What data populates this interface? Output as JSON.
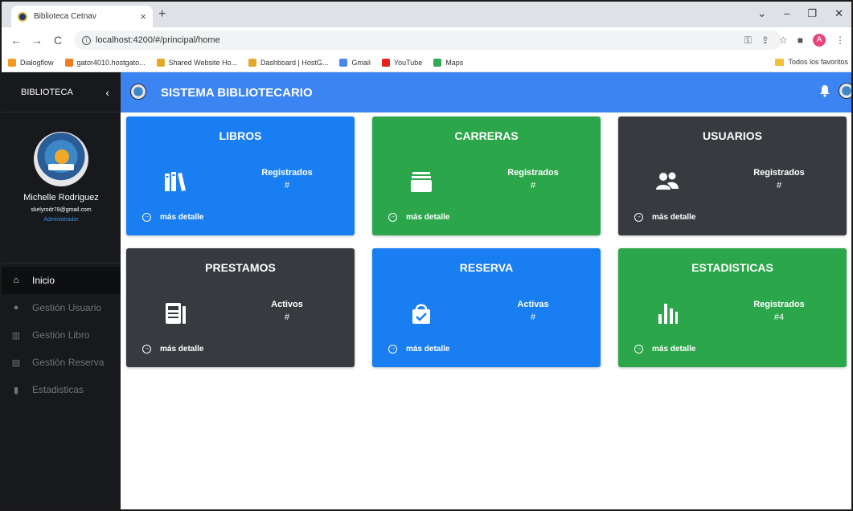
{
  "browser": {
    "tab_title": "Biblioteca Cetnav",
    "tab_close": "×",
    "new_tab": "+",
    "url": "localhost:4200/#/principal/home",
    "controls": {
      "minimize": "⌄",
      "min2": "–",
      "restore": "❐",
      "close": "✕"
    },
    "nav": {
      "back": "←",
      "forward": "→",
      "reload": "C"
    },
    "profile_initial": "A",
    "bookmarks": [
      {
        "label": "Dialogflow",
        "color": "#f29a1e"
      },
      {
        "label": "gator4010.hostgato...",
        "color": "#f07d22"
      },
      {
        "label": "Shared Website Ho...",
        "color": "#e5a72a"
      },
      {
        "label": "Dashboard | HostG...",
        "color": "#e5a72a"
      },
      {
        "label": "Gmail",
        "color": "#4a86f0"
      },
      {
        "label": "YouTube",
        "color": "#e62117"
      },
      {
        "label": "Maps",
        "color": "#34a853"
      }
    ],
    "bookmarks_folder": "Todos los favoritos"
  },
  "sidebar": {
    "brand": "BIBLIOTECA",
    "collapse_glyph": "‹",
    "user_name": "Michelle Rodriguez",
    "user_email": "skelyrodr78@gmail.com",
    "user_role": "Administrador",
    "items": [
      {
        "label": "Inicio",
        "icon": "home-icon",
        "glyph": "⌂"
      },
      {
        "label": "Gestión Usuario",
        "icon": "user-icon",
        "glyph": "●"
      },
      {
        "label": "Gestión Libro",
        "icon": "books-icon",
        "glyph": "▥"
      },
      {
        "label": "Gestión Reserva",
        "icon": "calendar-icon",
        "glyph": "▤"
      },
      {
        "label": "Estadisticas",
        "icon": "chart-icon",
        "glyph": "▮"
      }
    ]
  },
  "topbar": {
    "title": "SISTEMA BIBLIOTECARIO"
  },
  "cards": [
    {
      "title": "LIBROS",
      "label": "Registrados",
      "value": "#",
      "more": "más detalle",
      "color": "#1a7ef3"
    },
    {
      "title": "CARRERAS",
      "label": "Registrados",
      "value": "#",
      "more": "más detalle",
      "color": "#2ca64a"
    },
    {
      "title": "USUARIOS",
      "label": "Registrados",
      "value": "#",
      "more": "más detalle",
      "color": "#373b40"
    },
    {
      "title": "PRESTAMOS",
      "label": "Activos",
      "value": "#",
      "more": "más detalle",
      "color": "#373b40"
    },
    {
      "title": "RESERVA",
      "label": "Activas",
      "value": "#",
      "more": "más detalle",
      "color": "#1a7ef3"
    },
    {
      "title": "ESTADISTICAS",
      "label": "Registrados",
      "value": "#4",
      "more": "más detalle",
      "color": "#2ca64a"
    }
  ]
}
